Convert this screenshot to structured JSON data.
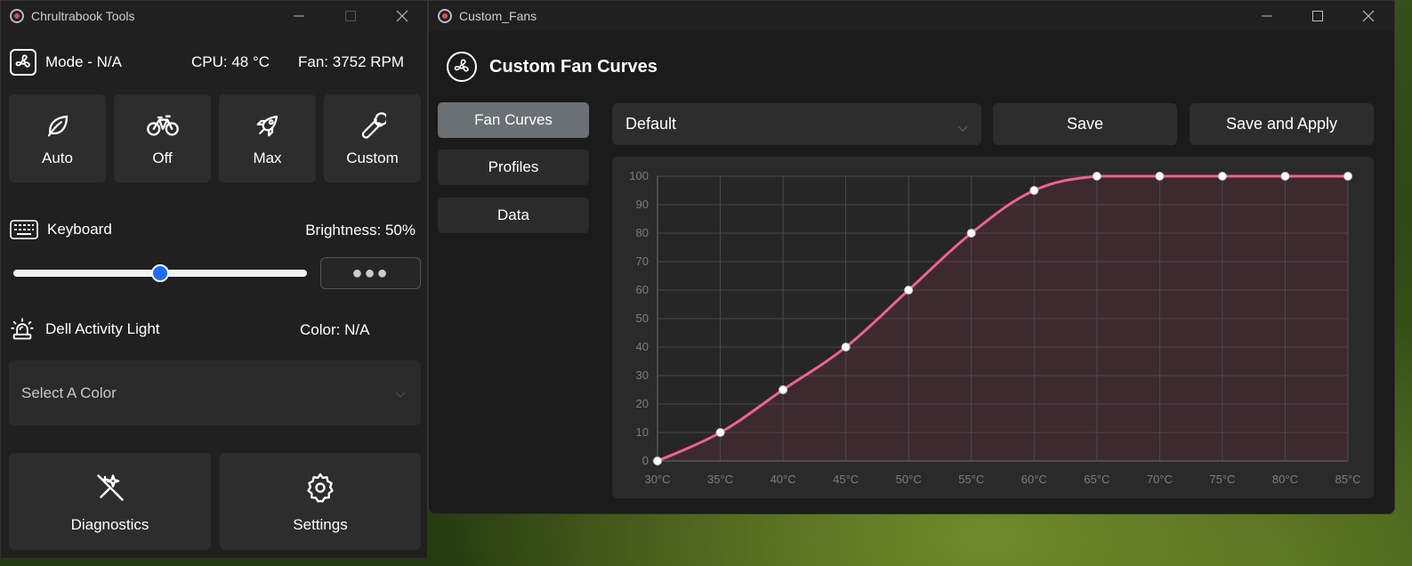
{
  "left_window": {
    "title": "Chrultrabook Tools",
    "status": {
      "mode": "Mode - N/A",
      "cpu": "CPU: 48 °C",
      "fan": "Fan: 3752 RPM"
    },
    "modes": [
      {
        "label": "Auto",
        "icon": "leaf-icon"
      },
      {
        "label": "Off",
        "icon": "bicycle-icon"
      },
      {
        "label": "Max",
        "icon": "rocket-icon"
      },
      {
        "label": "Custom",
        "icon": "wrench-icon"
      }
    ],
    "keyboard": {
      "label": "Keyboard",
      "brightness": "Brightness: 50%",
      "brightness_value": 0.5,
      "more_label": "●●●"
    },
    "activity_light": {
      "label": "Dell Activity Light",
      "color": "Color: N/A",
      "select_placeholder": "Select A Color"
    },
    "bottom": {
      "diagnostics": "Diagnostics",
      "settings": "Settings"
    }
  },
  "right_window": {
    "title": "Custom_Fans",
    "header": "Custom Fan Curves",
    "nav": [
      "Fan Curves",
      "Profiles",
      "Data"
    ],
    "active_nav": 0,
    "profile_selected": "Default",
    "save_label": "Save",
    "save_apply_label": "Save and Apply"
  },
  "colors": {
    "curve": "#f06292",
    "fill": "#3d2a2f",
    "accent": "#1e6bff"
  },
  "chart_data": {
    "type": "area",
    "x": [
      30,
      35,
      40,
      45,
      50,
      55,
      60,
      65,
      70,
      75,
      80,
      85
    ],
    "x_labels": [
      "30°C",
      "35°C",
      "40°C",
      "45°C",
      "50°C",
      "55°C",
      "60°C",
      "65°C",
      "70°C",
      "75°C",
      "80°C",
      "85°C"
    ],
    "values": [
      0,
      10,
      25,
      40,
      60,
      80,
      95,
      100,
      100,
      100,
      100,
      100
    ],
    "y_ticks": [
      0,
      10,
      20,
      30,
      40,
      50,
      60,
      70,
      80,
      90,
      100
    ],
    "xlim": [
      30,
      85
    ],
    "ylim": [
      0,
      100
    ],
    "grid": true,
    "title": "",
    "xlabel": "",
    "ylabel": ""
  }
}
